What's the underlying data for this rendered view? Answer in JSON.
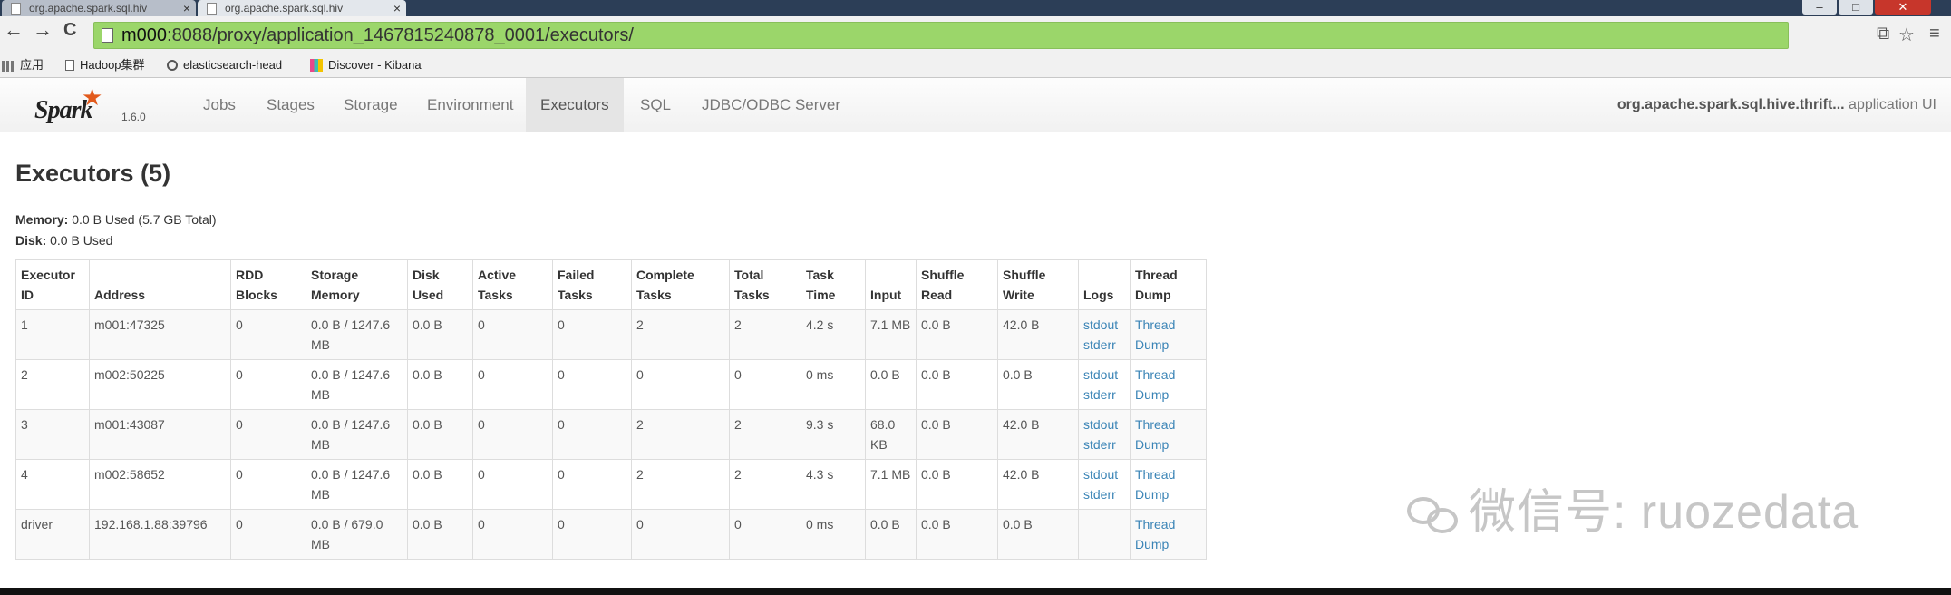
{
  "browser": {
    "tabs": [
      {
        "title": "org.apache.spark.sql.hiv",
        "close": "×"
      },
      {
        "title": "org.apache.spark.sql.hiv",
        "close": "×"
      }
    ],
    "window_buttons": {
      "minimize": "–",
      "maximize": "□",
      "close": "✕"
    },
    "nav": {
      "back": "←",
      "forward": "→",
      "reload": "C"
    },
    "address": {
      "host": "m000",
      "rest": ":8088/proxy/application_1467815240878_0001/executors/"
    },
    "bookmarks": [
      "应用",
      "Hadoop集群",
      "elasticsearch-head",
      "Discover - Kibana"
    ]
  },
  "spark_nav": {
    "logo": "Spark",
    "version": "1.6.0",
    "items": [
      "Jobs",
      "Stages",
      "Storage",
      "Environment",
      "Executors",
      "SQL",
      "JDBC/ODBC Server"
    ],
    "active": "Executors",
    "app_name": "org.apache.spark.sql.hive.thrift...",
    "app_suffix": " application UI"
  },
  "page": {
    "title": "Executors (5)",
    "memory_label": "Memory:",
    "memory_value": " 0.0 B Used (5.7 GB Total)",
    "disk_label": "Disk:",
    "disk_value": " 0.0 B Used"
  },
  "table": {
    "headers": [
      [
        "Executor",
        "ID"
      ],
      [
        "Address"
      ],
      [
        "RDD",
        "Blocks"
      ],
      [
        "Storage",
        "Memory"
      ],
      [
        "Disk",
        "Used"
      ],
      [
        "Active",
        "Tasks"
      ],
      [
        "Failed",
        "Tasks"
      ],
      [
        "Complete",
        "Tasks"
      ],
      [
        "Total",
        "Tasks"
      ],
      [
        "Task",
        "Time"
      ],
      [
        "Input"
      ],
      [
        "Shuffle",
        "Read"
      ],
      [
        "Shuffle",
        "Write"
      ],
      [
        "Logs"
      ],
      [
        "Thread",
        "Dump"
      ]
    ],
    "rows": [
      {
        "id": "1",
        "address": "m001:47325",
        "rdd": "0",
        "storage": "0.0 B / 1247.6 MB",
        "disk": "0.0 B",
        "active": "0",
        "failed": "0",
        "complete": "2",
        "total": "2",
        "time": "4.2 s",
        "input": "7.1 MB",
        "shuffle_read": "0.0 B",
        "shuffle_write": "42.0 B",
        "stdout": "stdout",
        "stderr": "stderr",
        "thread": "Thread Dump"
      },
      {
        "id": "2",
        "address": "m002:50225",
        "rdd": "0",
        "storage": "0.0 B / 1247.6 MB",
        "disk": "0.0 B",
        "active": "0",
        "failed": "0",
        "complete": "0",
        "total": "0",
        "time": "0 ms",
        "input": "0.0 B",
        "shuffle_read": "0.0 B",
        "shuffle_write": "0.0 B",
        "stdout": "stdout",
        "stderr": "stderr",
        "thread": "Thread Dump"
      },
      {
        "id": "3",
        "address": "m001:43087",
        "rdd": "0",
        "storage": "0.0 B / 1247.6 MB",
        "disk": "0.0 B",
        "active": "0",
        "failed": "0",
        "complete": "2",
        "total": "2",
        "time": "9.3 s",
        "input": "68.0 KB",
        "shuffle_read": "0.0 B",
        "shuffle_write": "42.0 B",
        "stdout": "stdout",
        "stderr": "stderr",
        "thread": "Thread Dump"
      },
      {
        "id": "4",
        "address": "m002:58652",
        "rdd": "0",
        "storage": "0.0 B / 1247.6 MB",
        "disk": "0.0 B",
        "active": "0",
        "failed": "0",
        "complete": "2",
        "total": "2",
        "time": "4.3 s",
        "input": "7.1 MB",
        "shuffle_read": "0.0 B",
        "shuffle_write": "42.0 B",
        "stdout": "stdout",
        "stderr": "stderr",
        "thread": "Thread Dump"
      },
      {
        "id": "driver",
        "address": "192.168.1.88:39796",
        "rdd": "0",
        "storage": "0.0 B / 679.0 MB",
        "disk": "0.0 B",
        "active": "0",
        "failed": "0",
        "complete": "0",
        "total": "0",
        "time": "0 ms",
        "input": "0.0 B",
        "shuffle_read": "0.0 B",
        "shuffle_write": "0.0 B",
        "stdout": "",
        "stderr": "",
        "thread": "Thread Dump"
      }
    ]
  },
  "watermark": "微信号: ruozedata",
  "colors": {
    "link": "#3a84b6",
    "address_bar": "#9bd66a",
    "spark_orange": "#e25a1c"
  }
}
